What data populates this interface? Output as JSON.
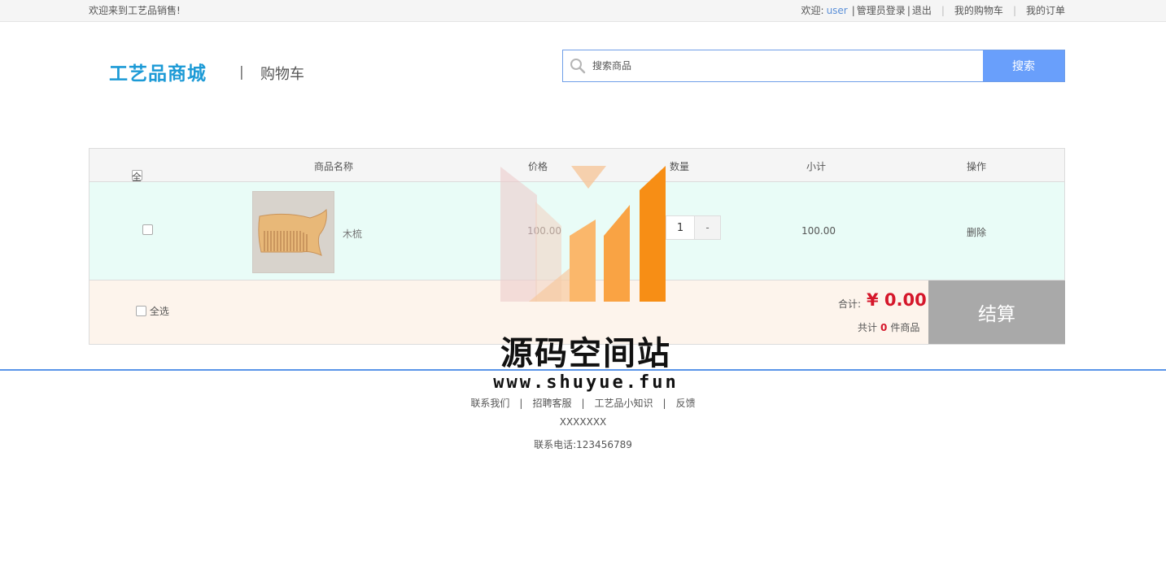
{
  "topbar": {
    "welcome": "欢迎来到工艺品销售!",
    "greeting": "欢迎:",
    "username": "user",
    "admin_login": "管理员登录",
    "logout": "退出",
    "my_cart": "我的购物车",
    "my_orders": "我的订单"
  },
  "header": {
    "logo": "工艺品商城",
    "page_name": "购物车",
    "search_placeholder": "搜索商品",
    "search_button": "搜索"
  },
  "cart": {
    "columns": {
      "select_all": "全选",
      "name": "商品名称",
      "price": "价格",
      "quantity": "数量",
      "subtotal": "小计",
      "action": "操作"
    },
    "items": [
      {
        "name": "木梳",
        "price": "100.00",
        "quantity": "1",
        "minus": "-",
        "subtotal": "100.00",
        "action": "删除",
        "checked": false
      }
    ],
    "footer": {
      "select_all": "全选",
      "total_label": "合计:",
      "total_value": "¥ 0.00",
      "count_prefix": "共计",
      "count": "0",
      "count_suffix": "件商品",
      "checkout": "结算"
    }
  },
  "footer": {
    "links": [
      "联系我们",
      "招聘客服",
      "工艺品小知识",
      "反馈"
    ],
    "address": "XXXXXXX",
    "phone": "联系电话:123456789"
  },
  "watermark": {
    "title": "源码空间站",
    "url": "www.shuyue.fun"
  },
  "colors": {
    "accent": "#1c9ad6",
    "search_button": "#699ffb",
    "price_red": "#d5172b",
    "row_bg": "#e9fcf7",
    "footer_bg": "#fdf4ec",
    "checkout_bg": "#a9a9a9"
  }
}
